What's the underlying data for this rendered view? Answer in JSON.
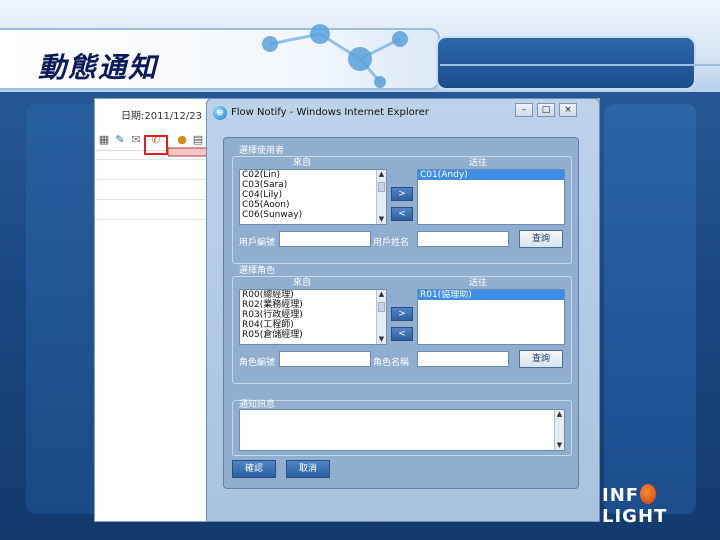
{
  "slide": {
    "title": "動態通知",
    "logo_prefix": "INF",
    "logo_suffix": "LIGHT",
    "colors": {
      "accent": "#1f4d88",
      "title": "#0a1a5c",
      "highlight": "#e02020"
    }
  },
  "background_app": {
    "date_text": "日期:2011/12/23",
    "toolbar_icons": [
      "save-icon",
      "edit-icon",
      "mail-icon",
      "notify-icon",
      "user-icon",
      "print-icon"
    ]
  },
  "ie_window": {
    "title": "Flow Notify - Windows Internet Explorer",
    "controls": {
      "minimize": "–",
      "maximize": "□",
      "close": "×"
    }
  },
  "users_section": {
    "title": "選擇使用者",
    "source_label": "來自",
    "target_label": "送往",
    "source_items": [
      "C02(Lin)",
      "C03(Sara)",
      "C04(Lily)",
      "C05(Aoon)",
      "C06(Sunway)"
    ],
    "target_items": [
      "C01(Andy)"
    ],
    "add_label": ">",
    "remove_label": "<",
    "user_id_label": "用戶編號",
    "user_name_label": "用戶姓名",
    "query_label": "查詢"
  },
  "roles_section": {
    "title": "選擇角色",
    "source_label": "來自",
    "target_label": "送往",
    "source_items": [
      "R00(總經理)",
      "R02(業務經理)",
      "R03(行政經理)",
      "R04(工程師)",
      "R05(倉儲經理)"
    ],
    "target_items": [
      "R01(協理助)"
    ],
    "add_label": ">",
    "remove_label": "<",
    "role_id_label": "角色編號",
    "role_name_label": "角色名稱",
    "query_label": "查詢"
  },
  "message_section": {
    "title": "通知訊息"
  },
  "actions": {
    "confirm_label": "確認",
    "cancel_label": "取消"
  }
}
